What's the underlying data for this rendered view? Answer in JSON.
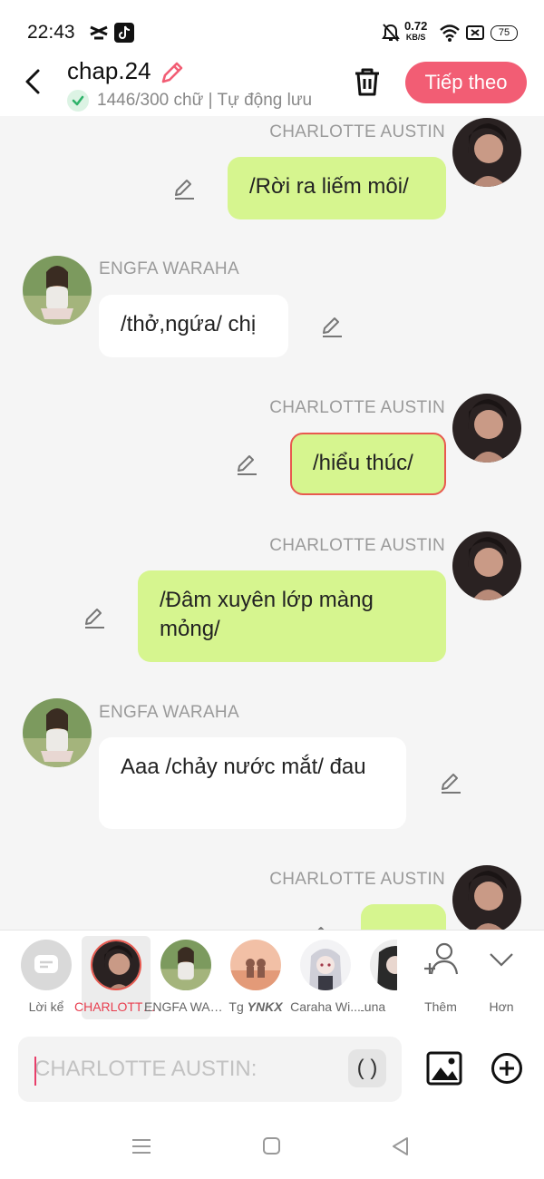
{
  "status_bar": {
    "time": "22:43",
    "net_speed_value": "0.72",
    "net_speed_unit": "KB/S",
    "battery": "75"
  },
  "header": {
    "title": "chap.24",
    "subtitle": "1446/300 chữ | Tự động lưu",
    "next_button": "Tiếp theo"
  },
  "messages": [
    {
      "side": "right",
      "sender": "CHARLOTTE AUSTIN",
      "text": "/Rời ra liếm môi/",
      "color": "#d6f58f"
    },
    {
      "side": "left",
      "sender": "ENGFA WARAHA",
      "text": "/thở,ngứa/ chị",
      "color": "#ffffff"
    },
    {
      "side": "right",
      "sender": "CHARLOTTE AUSTIN",
      "text": "/hiểu thúc/",
      "color": "#d6f58f",
      "selected": true
    },
    {
      "side": "right",
      "sender": "CHARLOTTE AUSTIN",
      "text": "/Đâm xuyên lớp màng mỏng/",
      "color": "#d6f58f"
    },
    {
      "side": "left",
      "sender": "ENGFA WARAHA",
      "text": "Aaa /chảy nước mắt/ đau",
      "color": "#ffffff"
    },
    {
      "side": "right",
      "sender": "CHARLOTTE AUSTIN",
      "text": "",
      "color": "#d6f58f"
    }
  ],
  "character_bar": {
    "items": [
      {
        "label": "Lời kể",
        "icon": "narration-icon"
      },
      {
        "label": "CHARLOTTE AUSTIN",
        "selected": true
      },
      {
        "label": "ENGFA WARAHA"
      },
      {
        "label_prefix": "Tg ",
        "label_emph": "YNKX"
      },
      {
        "label": "Caraha Wi..."
      },
      {
        "label": "Luna"
      },
      {
        "label": "Thêm",
        "icon": "add-person-icon"
      },
      {
        "label": "Hơn",
        "icon": "chevron-down-icon"
      }
    ]
  },
  "composer": {
    "placeholder": "CHARLOTTE AUSTIN:",
    "paren_button": "( )"
  },
  "colors": {
    "accent": "#f25d74",
    "bubble_green": "#d6f58f",
    "selected_label": "#e83e4f"
  }
}
